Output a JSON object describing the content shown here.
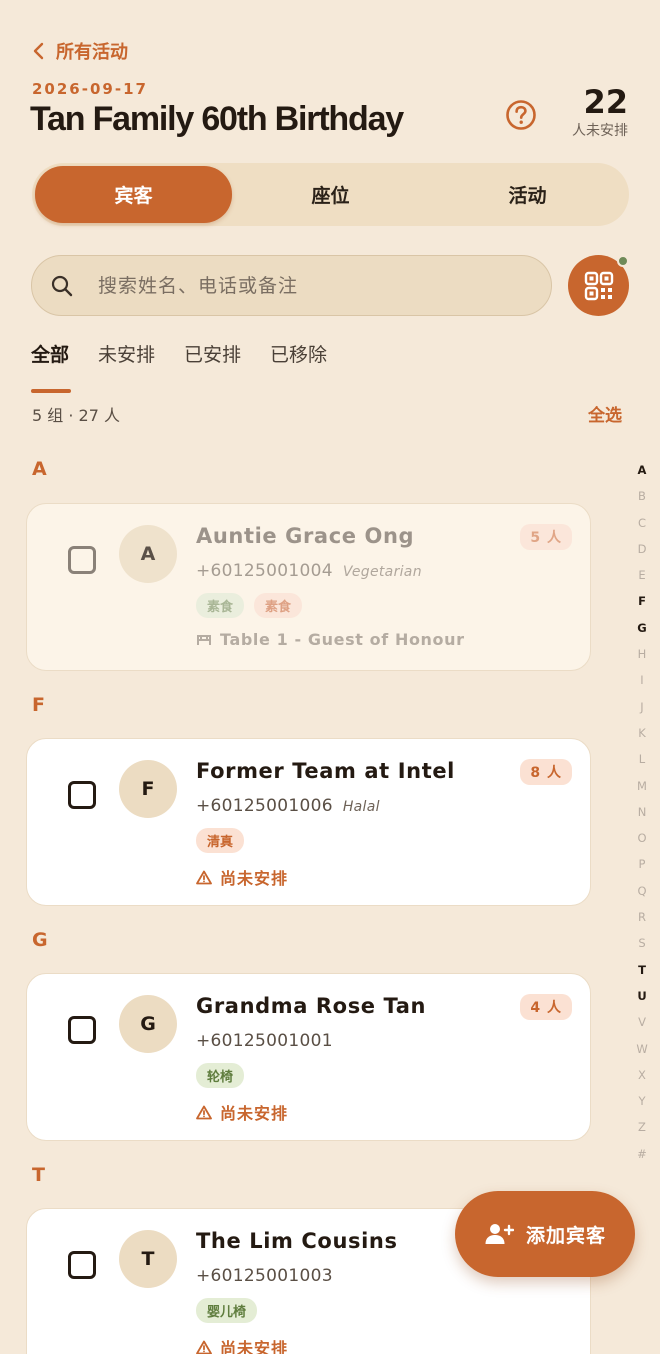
{
  "nav": {
    "back_label": "所有活动"
  },
  "event": {
    "date": "2026-09-17",
    "title": "Tan Family 60th Birthday"
  },
  "unassigned": {
    "count": "22",
    "label": "人未安排"
  },
  "segments": [
    {
      "label": "宾客",
      "active": true
    },
    {
      "label": "座位",
      "active": false
    },
    {
      "label": "活动",
      "active": false
    }
  ],
  "search": {
    "placeholder": "搜索姓名、电话或备注"
  },
  "filters": [
    {
      "label": "全部",
      "active": true
    },
    {
      "label": "未安排",
      "active": false
    },
    {
      "label": "已安排",
      "active": false
    },
    {
      "label": "已移除",
      "active": false
    }
  ],
  "summary": {
    "text": "5 组 · 27 人",
    "select_all": "全选"
  },
  "sections": [
    {
      "letter": "A",
      "guest": {
        "initial": "A",
        "name": "Auntie Grace Ong",
        "phone": "+60125001004",
        "note": "Vegetarian",
        "tags": [
          {
            "label": "素食",
            "color": "green"
          },
          {
            "label": "素食",
            "color": "peach"
          }
        ],
        "status": "Table 1 - Guest of Honour",
        "status_icon": "table-icon",
        "count": "5 人",
        "dimmed": true
      }
    },
    {
      "letter": "F",
      "guest": {
        "initial": "F",
        "name": "Former Team at Intel",
        "phone": "+60125001006",
        "note": "Halal",
        "tags": [
          {
            "label": "清真",
            "color": "peach"
          }
        ],
        "status": "尚未安排",
        "status_icon": "warning-icon",
        "count": "8 人",
        "dimmed": false
      }
    },
    {
      "letter": "G",
      "guest": {
        "initial": "G",
        "name": "Grandma Rose Tan",
        "phone": "+60125001001",
        "note": "",
        "tags": [
          {
            "label": "轮椅",
            "color": "green"
          }
        ],
        "status": "尚未安排",
        "status_icon": "warning-icon",
        "count": "4 人",
        "dimmed": false
      }
    },
    {
      "letter": "T",
      "guest": {
        "initial": "T",
        "name": "The Lim Cousins",
        "phone": "+60125001003",
        "note": "",
        "tags": [
          {
            "label": "婴儿椅",
            "color": "green"
          }
        ],
        "status": "尚未安排",
        "status_icon": "warning-icon",
        "count": "",
        "dimmed": false
      }
    }
  ],
  "alphabet": [
    "A",
    "B",
    "C",
    "D",
    "E",
    "F",
    "G",
    "H",
    "I",
    "J",
    "K",
    "L",
    "M",
    "N",
    "O",
    "P",
    "Q",
    "R",
    "S",
    "T",
    "U",
    "V",
    "W",
    "X",
    "Y",
    "Z",
    "#"
  ],
  "alphabet_active": [
    "A",
    "F",
    "G",
    "T",
    "U"
  ],
  "fab": {
    "label": "添加宾客"
  },
  "colors": {
    "accent": "#c8662e",
    "background": "#f5e9d9",
    "segment_bg": "#efdec3",
    "tag_green": "#5f7d3e"
  }
}
